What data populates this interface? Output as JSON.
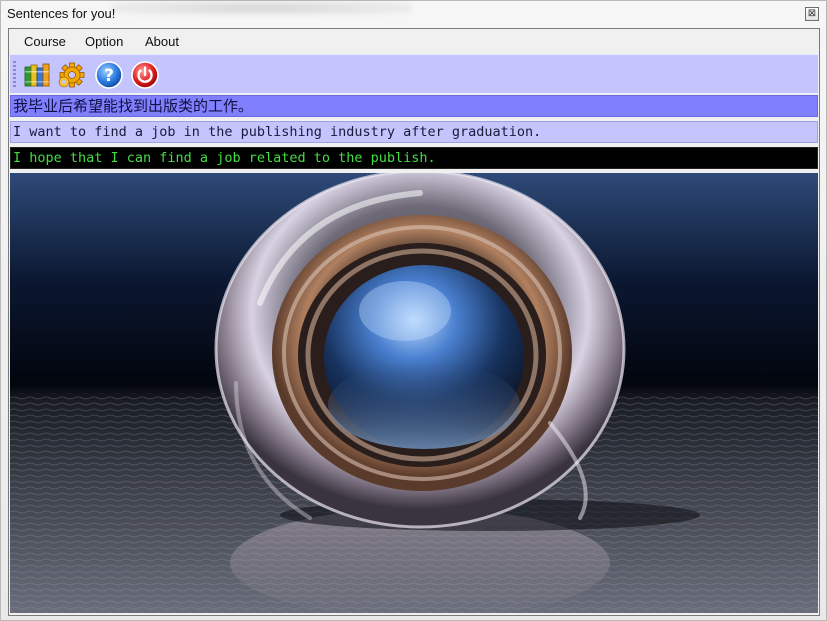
{
  "window": {
    "title": "Sentences for you!",
    "close_glyph": "⊠"
  },
  "menu": {
    "items": [
      {
        "label": "Course"
      },
      {
        "label": "Option"
      },
      {
        "label": "About"
      }
    ]
  },
  "toolbar": {
    "buttons": [
      {
        "icon": "books-icon"
      },
      {
        "icon": "gear-icon"
      },
      {
        "icon": "help-icon"
      },
      {
        "icon": "power-icon"
      }
    ]
  },
  "sentences": {
    "chinese": "我毕业后希望能找到出版类的工作。",
    "english": "I want to find a job in the publishing industry after graduation.",
    "user_answer": "I hope that I can find a job related to the publish."
  },
  "colors": {
    "chinese_line_bg": "#8080ff",
    "english_line_bg": "#c4c4ff",
    "answer_line_bg": "#000000",
    "answer_text": "#44dd44",
    "toolbar_bg": "#c4c4ff"
  }
}
